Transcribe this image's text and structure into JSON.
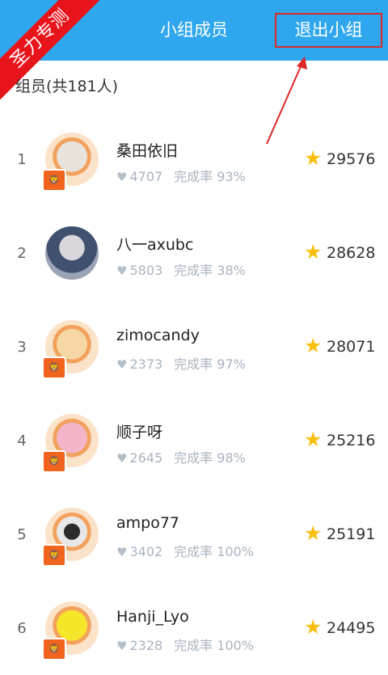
{
  "header": {
    "title": "小组成员",
    "exit_label": "退出小组"
  },
  "watermark": "圣力专测",
  "member_count": "组员(共181人)",
  "labels": {
    "completion_prefix": "完成率"
  },
  "colors": {
    "header_bg": "#2ea7ee",
    "highlight_border": "#e02828",
    "star": "#f9bf10"
  },
  "members": [
    {
      "rank": "1",
      "name": "桑田依旧",
      "likes": "4707",
      "completion": "93%",
      "score": "29576"
    },
    {
      "rank": "2",
      "name": "八一axubc",
      "likes": "5803",
      "completion": "38%",
      "score": "28628"
    },
    {
      "rank": "3",
      "name": "zimocandy",
      "likes": "2373",
      "completion": "97%",
      "score": "28071"
    },
    {
      "rank": "4",
      "name": "顺子呀",
      "likes": "2645",
      "completion": "98%",
      "score": "25216"
    },
    {
      "rank": "5",
      "name": "ampo77",
      "likes": "3402",
      "completion": "100%",
      "score": "25191"
    },
    {
      "rank": "6",
      "name": "Hanji_Lyo",
      "likes": "2328",
      "completion": "100%",
      "score": "24495"
    }
  ]
}
